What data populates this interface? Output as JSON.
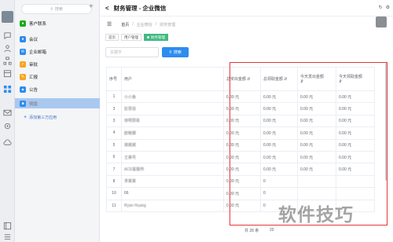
{
  "app": {
    "window_title": "财务管理 - 企业微信"
  },
  "sidebar": {
    "search_placeholder": "搜索",
    "items": [
      {
        "label": "客户联系",
        "color": "#1aad19"
      },
      {
        "label": "会议",
        "color": "#2d8cf0"
      },
      {
        "label": "企业邮箱",
        "color": "#2d8cf0"
      },
      {
        "label": "审批",
        "color": "#f5a623"
      },
      {
        "label": "汇报",
        "color": "#f5a623"
      },
      {
        "label": "公告",
        "color": "#2d8cf0"
      },
      {
        "label": "微盘",
        "color": "#2d8cf0"
      }
    ],
    "add_app_label": "添加第三方应用"
  },
  "nav": {
    "home": "首页",
    "crumb1": "企业微信",
    "crumb2": "财务管理"
  },
  "tabs": [
    {
      "label": "首页"
    },
    {
      "label": "用户管理"
    },
    {
      "label": "财务管理"
    }
  ],
  "search": {
    "placeholder": "关键字",
    "button": "搜索"
  },
  "table": {
    "headers": [
      "序号",
      "用户",
      "总奖出金额",
      "总领取金额",
      "今天发出金额",
      "今天领取金额"
    ],
    "rows": [
      {
        "idx": "1",
        "user": "小小鱼",
        "c1": "0.00 元",
        "c2": "0.00 元",
        "c3": "0.00 元",
        "c4": "0.00 元"
      },
      {
        "idx": "3",
        "user": "彭思佳",
        "c1": "0.00 元",
        "c2": "0.00 元",
        "c3": "0.00 元",
        "c4": "0.00 元"
      },
      {
        "idx": "3",
        "user": "徐明慧看",
        "c1": "0.00 元",
        "c2": "0.00 元",
        "c3": "0.00 元",
        "c4": "0.00 元"
      },
      {
        "idx": "4",
        "user": "欧敏娜",
        "c1": "0.00 元",
        "c2": "0.00 元",
        "c3": "0.00 元",
        "c4": "0.00 元"
      },
      {
        "idx": "5",
        "user": "谢崴崴",
        "c1": "0.00 元",
        "c2": "0.00 元",
        "c3": "0.00 元",
        "c4": "0.00 元"
      },
      {
        "idx": "6",
        "user": "王美号",
        "c1": "0.00 元",
        "c2": "0.00 元",
        "c3": "0.00 元",
        "c4": "0.00 元"
      },
      {
        "idx": "7",
        "user": "ACE客服伟",
        "c1": "0.00 元",
        "c2": "0.00 元",
        "c3": "0.00 元",
        "c4": "0.00 元"
      },
      {
        "idx": "8",
        "user": "李某某",
        "c1": "0.00 元",
        "c2": "0",
        "c3": "",
        "c4": ""
      },
      {
        "idx": "10",
        "user": "66",
        "c1": "0.00 元",
        "c2": "0",
        "c3": "",
        "c4": ""
      },
      {
        "idx": "11",
        "user": "Ryan Huang",
        "c1": "0.00 元",
        "c2": "0",
        "c3": "",
        "c4": ""
      }
    ]
  },
  "pagination": {
    "total": "共 28 条",
    "size": "20"
  },
  "watermark": "软件技巧",
  "colors": {
    "accent": "#2d8cf0",
    "active_tab": "#42b983",
    "highlight_box": "#e23b3b",
    "sidebar_active": "#a9c8f0"
  }
}
